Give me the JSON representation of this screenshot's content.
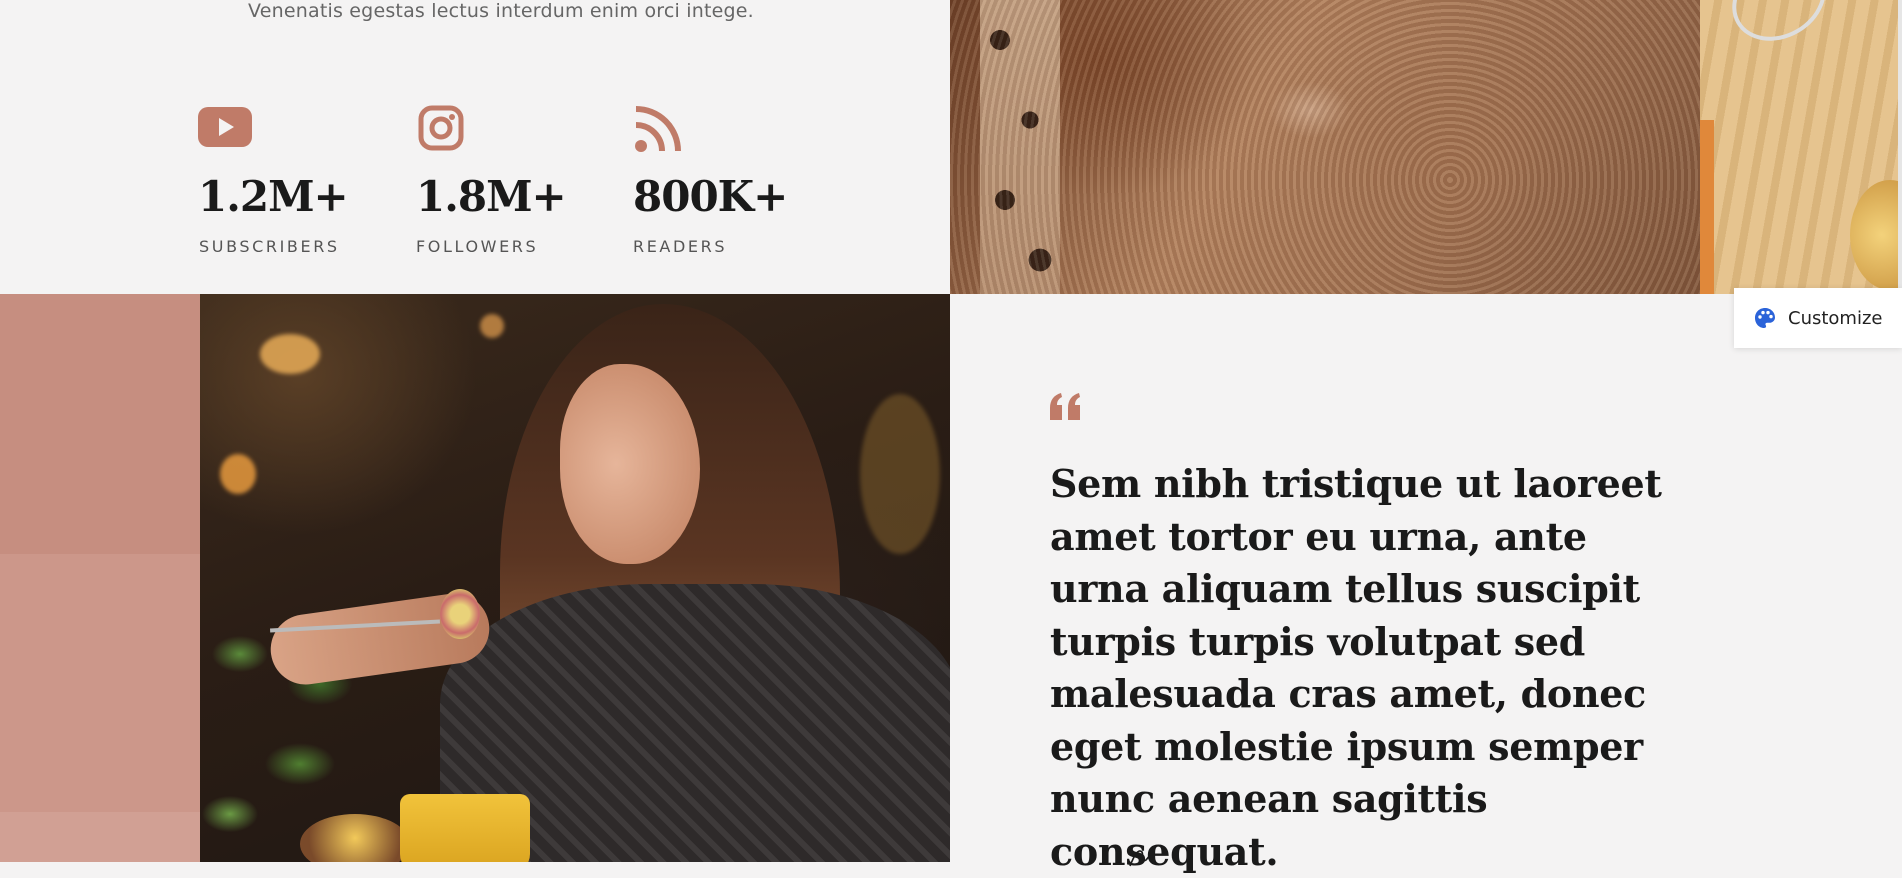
{
  "intro": {
    "tagline": "Venenatis egestas lectus interdum enim orci intege."
  },
  "stats": [
    {
      "icon": "youtube-icon",
      "value": "1.2M+",
      "label": "SUBSCRIBERS"
    },
    {
      "icon": "instagram-icon",
      "value": "1.8M+",
      "label": "FOLLOWERS"
    },
    {
      "icon": "rss-icon",
      "value": "800K+",
      "label": "READERS"
    }
  ],
  "testimonial": {
    "quote": "Sem nibh tristique ut laoreet amet tortor eu urna, ante urna aliquam tellus suscipit turpis turpis volutpat sed malesuada cras amet, donec eget molestie ipsum semper nunc aenean sagittis consequat."
  },
  "customize_widget": {
    "label": "Customize",
    "icon": "palette-icon"
  },
  "colors": {
    "accent": "#c07b68",
    "background": "#f4f3f3",
    "text": "#1a1a1a",
    "customize_icon": "#2b63d9"
  }
}
